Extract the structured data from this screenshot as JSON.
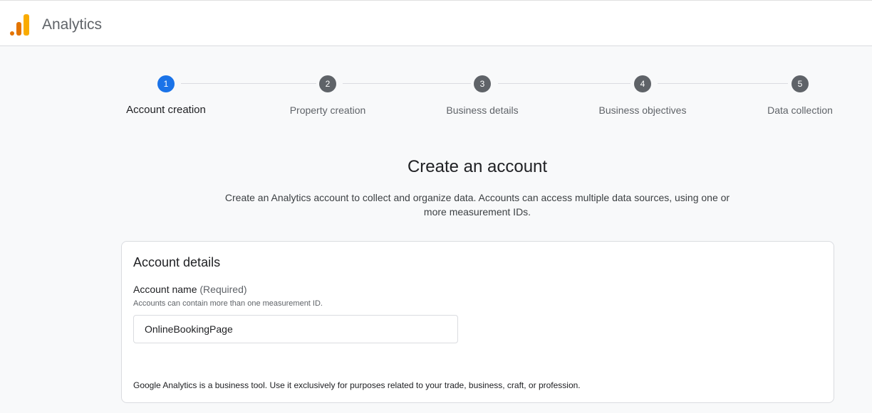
{
  "header": {
    "app_title": "Analytics",
    "logo_icon": "analytics-bars-icon",
    "logo_colors": [
      "#e37400",
      "#f9ab00"
    ]
  },
  "stepper": {
    "steps": [
      {
        "number": "1",
        "label": "Account creation",
        "active": true
      },
      {
        "number": "2",
        "label": "Property creation",
        "active": false
      },
      {
        "number": "3",
        "label": "Business details",
        "active": false
      },
      {
        "number": "4",
        "label": "Business objectives",
        "active": false
      },
      {
        "number": "5",
        "label": "Data collection",
        "active": false
      }
    ],
    "active_color": "#1a73e8",
    "inactive_color": "#5f6368"
  },
  "main": {
    "heading": "Create an account",
    "description_line1": "Create an Analytics account to collect and organize data. Accounts can access multiple data sources, using one or",
    "description_line2": "more measurement IDs."
  },
  "account_details": {
    "title": "Account details",
    "account_name_label": "Account name",
    "account_name_required": "(Required)",
    "account_name_hint": "Accounts can contain more than one measurement ID.",
    "account_name_value": "OnlineBookingPage",
    "disclaimer": "Google Analytics is a business tool. Use it exclusively for purposes related to your trade, business, craft, or profession."
  }
}
